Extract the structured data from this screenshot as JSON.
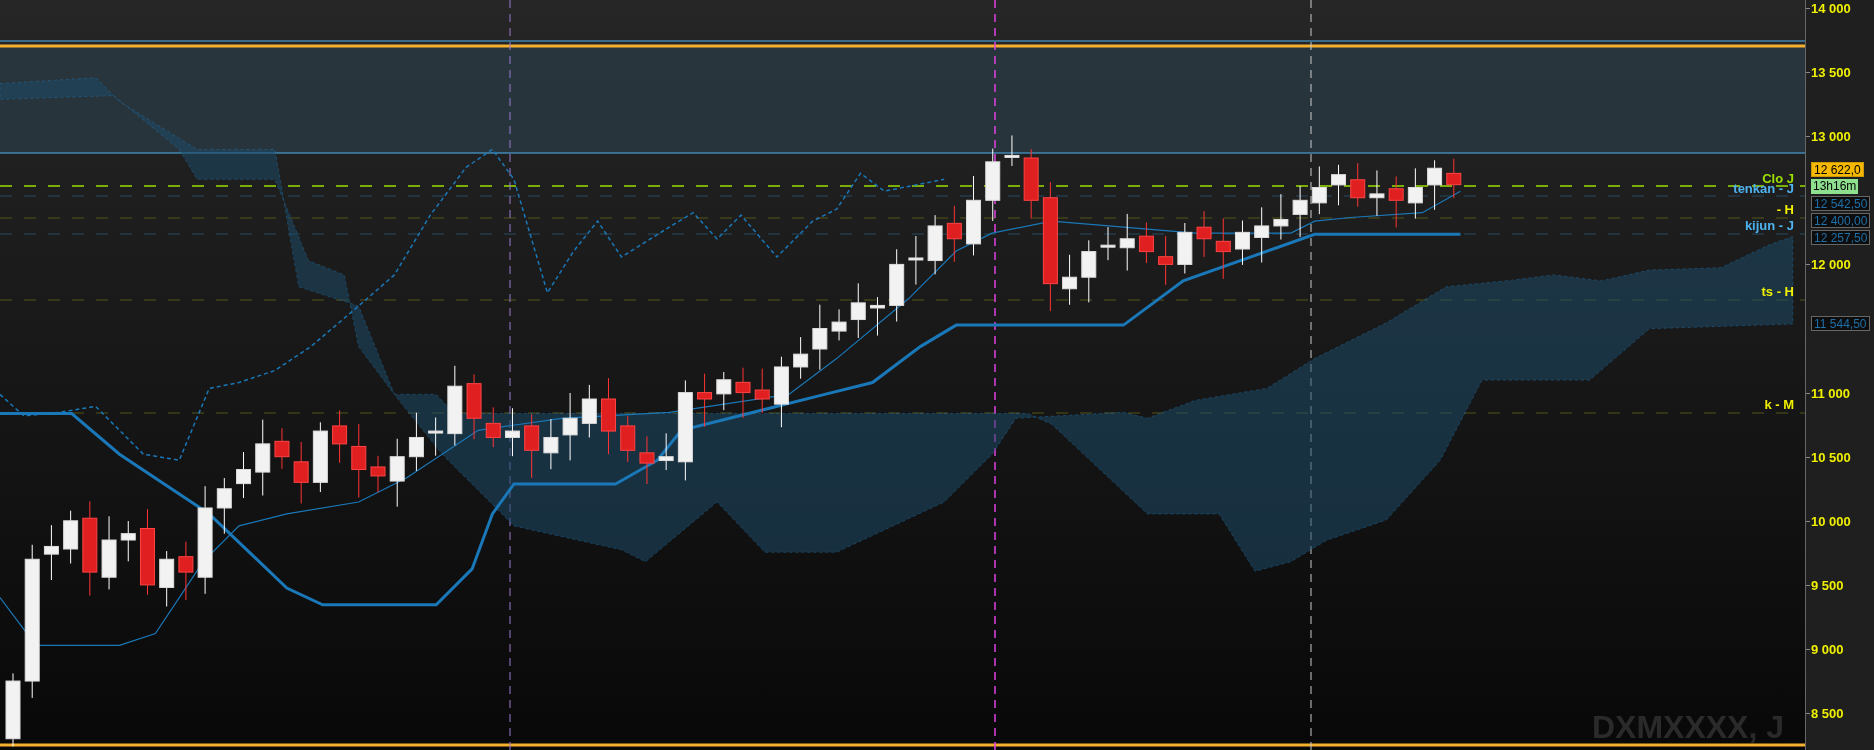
{
  "chart": {
    "symbol": "DXMXXXX, J",
    "price_axis": {
      "ticks": [
        "14 000",
        "13 500",
        "13 000",
        "12 000",
        "11 000",
        "10 500",
        "10 000",
        "9 500",
        "9 000",
        "8 500"
      ]
    },
    "line_labels": [
      {
        "text": "Clo J",
        "color": "#9be000"
      },
      {
        "text": "tenkan - J",
        "color": "#4fb3f0"
      },
      {
        "text": "- H",
        "color": "#f0f000"
      },
      {
        "text": "kijun - J",
        "color": "#4fb3f0"
      },
      {
        "text": "ts - H",
        "color": "#f0f000"
      },
      {
        "text": "k - M",
        "color": "#f0f000"
      }
    ],
    "price_tags": [
      {
        "text": "12 622,0",
        "kind": "last"
      },
      {
        "text": "13h16m",
        "kind": "timer"
      },
      {
        "text": "12 542,50",
        "kind": "level"
      },
      {
        "text": "12 400,00",
        "kind": "level"
      },
      {
        "text": "12 257,50",
        "kind": "level"
      },
      {
        "text": "11 544,50",
        "kind": "level"
      }
    ]
  }
}
